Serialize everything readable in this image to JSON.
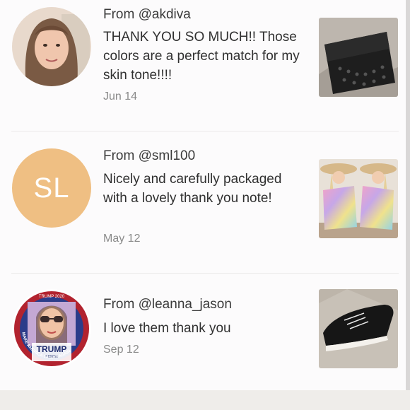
{
  "reviews": [
    {
      "handle": "From @akdiva",
      "message": "THANK YOU SO MUCH!! Those colors are a perfect match for my skin tone!!!!",
      "date": "Jun 14"
    },
    {
      "handle": "From @sml100",
      "avatar_initials": "SL",
      "avatar_color": "#efbf83",
      "message": "Nicely and carefully packaged with a lovely thank you note!",
      "date": "May 12"
    },
    {
      "handle": "From @leanna_jason",
      "message": "I love them thank you",
      "date": "Sep 12",
      "avatar_badge": {
        "top": "TRUMP 2020",
        "name": "TRUMP",
        "sub": "PENCE",
        "ring": "MAKE AMERICA GREAT AGAIN"
      }
    }
  ]
}
